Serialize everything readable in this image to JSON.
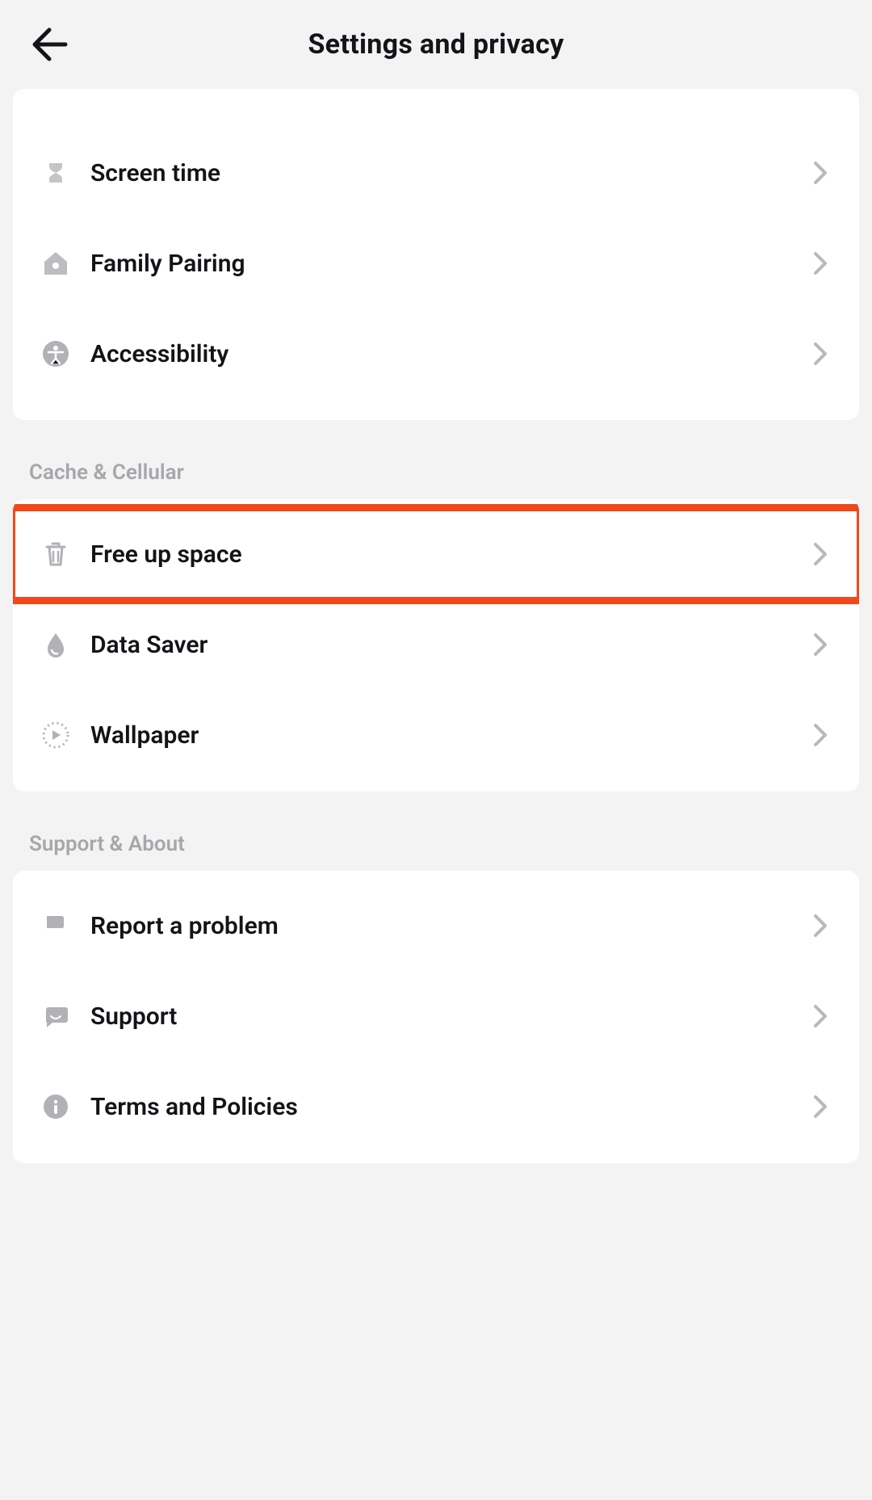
{
  "header": {
    "title": "Settings and privacy"
  },
  "groups": [
    {
      "header": null,
      "items": [
        {
          "icon": "hourglass-icon",
          "label": "Screen time"
        },
        {
          "icon": "house-icon",
          "label": "Family Pairing"
        },
        {
          "icon": "accessibility-icon",
          "label": "Accessibility"
        }
      ]
    },
    {
      "header": "Cache & Cellular",
      "items": [
        {
          "icon": "trash-icon",
          "label": "Free up space",
          "highlighted": true
        },
        {
          "icon": "drop-icon",
          "label": "Data Saver"
        },
        {
          "icon": "dotted-play-icon",
          "label": "Wallpaper"
        }
      ]
    },
    {
      "header": "Support & About",
      "items": [
        {
          "icon": "flag-icon",
          "label": "Report a problem"
        },
        {
          "icon": "chat-icon",
          "label": "Support"
        },
        {
          "icon": "info-icon",
          "label": "Terms and Policies"
        }
      ]
    }
  ]
}
